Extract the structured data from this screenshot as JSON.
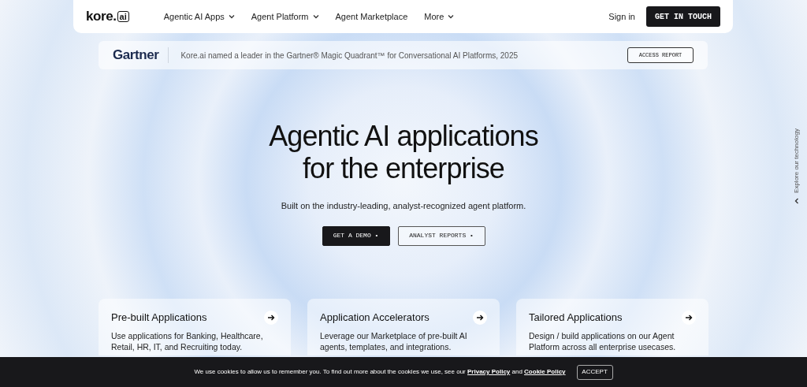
{
  "nav": {
    "logo": {
      "text": "kore.",
      "badge": "ai"
    },
    "items": [
      {
        "label": "Agentic AI Apps",
        "dropdown": true
      },
      {
        "label": "Agent Platform",
        "dropdown": true
      },
      {
        "label": "Agent Marketplace",
        "dropdown": false
      },
      {
        "label": "More",
        "dropdown": true
      }
    ],
    "sign_in": "Sign in",
    "cta": "GET IN TOUCH"
  },
  "announcement": {
    "brand": "Gartner",
    "text": "Kore.ai named a leader in the Gartner® Magic Quadrant™ for Conversational AI Platforms, 2025",
    "button": "ACCESS REPORT"
  },
  "hero": {
    "title_lines": [
      "Agentic AI applications",
      "for the enterprise"
    ],
    "subtitle": "Built on the industry-leading, analyst-recognized agent platform.",
    "buttons": [
      {
        "label": "GET A DEMO •",
        "kind": "primary"
      },
      {
        "label": "ANALYST REPORTS •",
        "kind": "secondary"
      }
    ]
  },
  "side_link": "Explore our technology",
  "cards": [
    {
      "title": "Pre-built Applications",
      "lines": [
        "Use applications for Banking, Healthcare,",
        "Retail, HR, IT, and Recruiting today."
      ]
    },
    {
      "title": "Application Accelerators",
      "lines": [
        "Leverage our Marketplace of pre-built AI",
        "agents, templates, and integrations."
      ]
    },
    {
      "title": "Tailored Applications",
      "lines": [
        "Design / build applications on our Agent",
        "Platform across all enterprise usecases."
      ]
    }
  ],
  "cookie_banner": {
    "text": "We use cookies to allow us to remember you. To find out more about the cookies we use, see our",
    "links": [
      "Privacy Policy",
      "Cookie Policy"
    ],
    "joiner": "and",
    "button": "ACCEPT"
  }
}
